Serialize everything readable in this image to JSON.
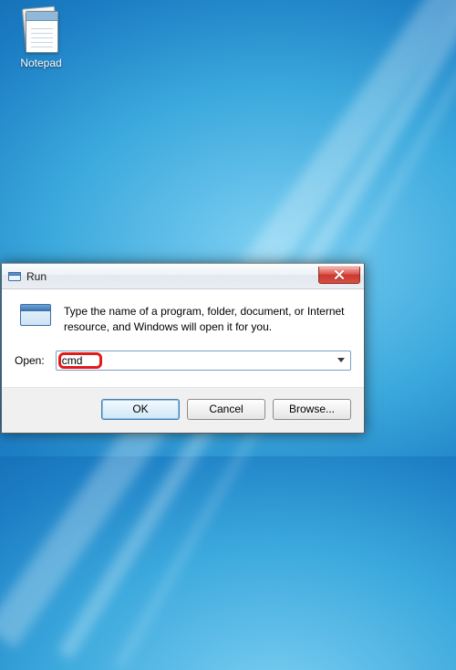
{
  "desktop": {
    "icons": [
      {
        "name": "notepad",
        "label": "Notepad"
      }
    ]
  },
  "run_dialog": {
    "title": "Run",
    "description": "Type the name of a program, folder, document, or Internet resource, and Windows will open it for you.",
    "open_label": "Open:",
    "open_value": "cmd",
    "buttons": {
      "ok": "OK",
      "cancel": "Cancel",
      "browse": "Browse..."
    }
  },
  "annotation": {
    "highlight_target": "open-input",
    "highlight_text": "cmd",
    "highlight_color": "#e11b1b"
  }
}
